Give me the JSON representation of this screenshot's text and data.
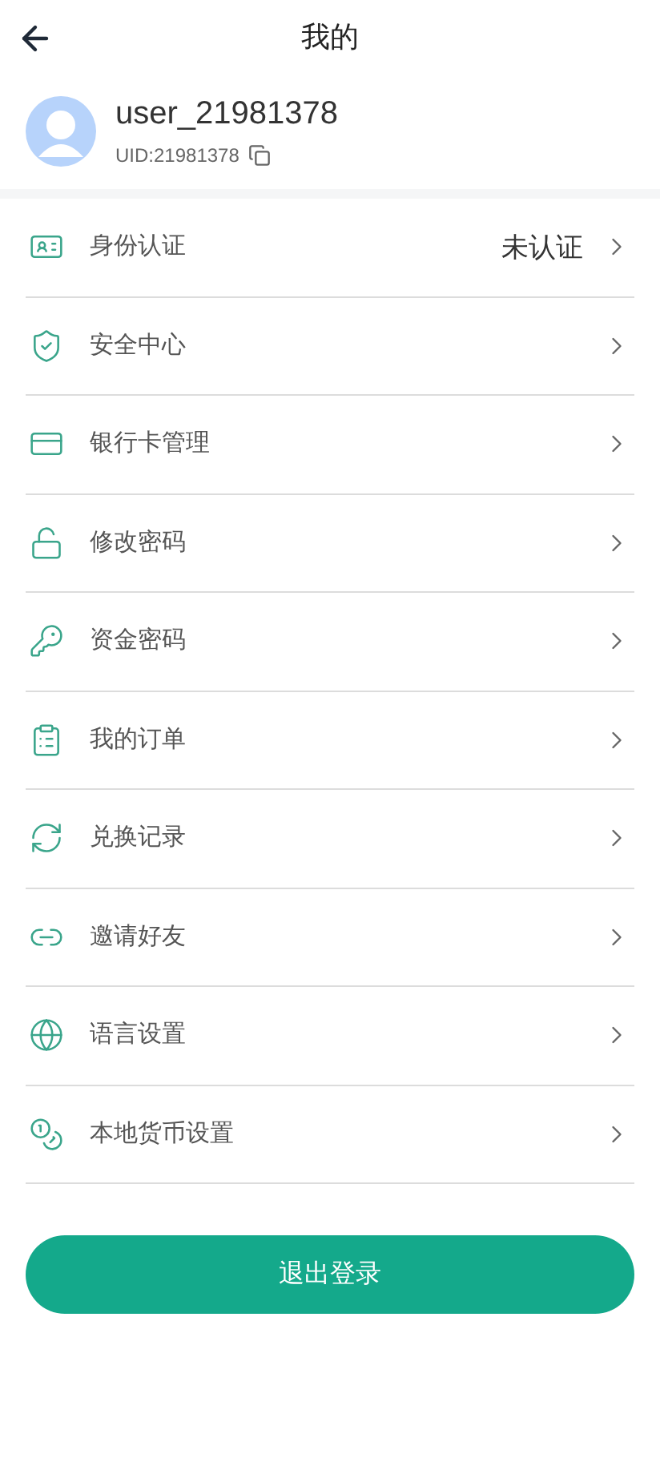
{
  "header": {
    "title": "我的"
  },
  "profile": {
    "username": "user_21981378",
    "uid": "UID:21981378"
  },
  "menu": [
    {
      "label": "身份认证",
      "value": "未认证"
    },
    {
      "label": "安全中心"
    },
    {
      "label": "银行卡管理"
    },
    {
      "label": "修改密码"
    },
    {
      "label": "资金密码"
    },
    {
      "label": "我的订单"
    },
    {
      "label": "兑换记录"
    },
    {
      "label": "邀请好友"
    },
    {
      "label": "语言设置"
    },
    {
      "label": "本地货币设置"
    }
  ],
  "logout_button": "退出登录"
}
